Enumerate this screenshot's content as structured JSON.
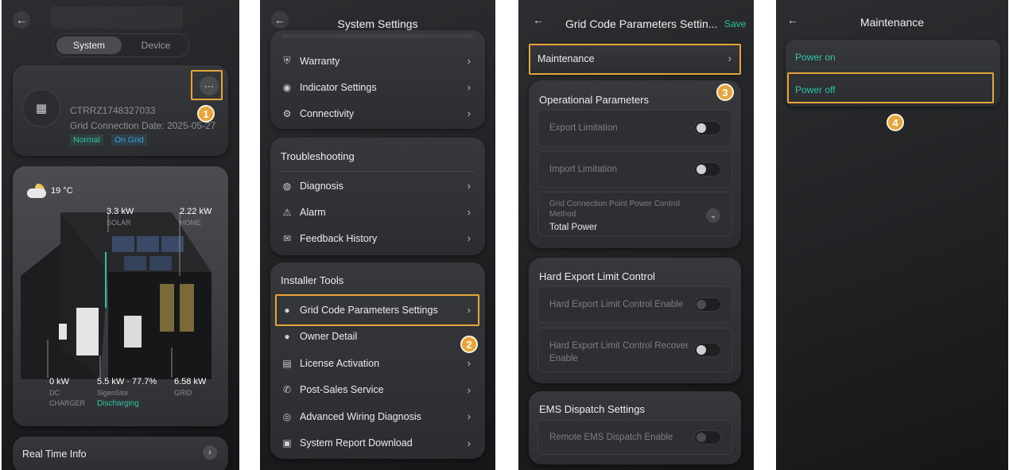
{
  "screen1": {
    "tabs": [
      "System",
      "Device"
    ],
    "device_id": "CTRRZ1748327033",
    "grid_date": "Grid Connection Date: 2025-05-27",
    "status_normal": "Normal",
    "status_grid": "On Grid",
    "weather_temp": "19 °C",
    "solar_value": "3.3 kW",
    "solar_label": "SOLAR",
    "home_value": "2.22 kW",
    "home_label": "HOME",
    "dc_value": "0 kW",
    "dc_label1": "DC",
    "dc_label2": "CHARGER",
    "battery_value": "5.5 kW · 77.7%",
    "battery_label": "SigenStor",
    "battery_state": "Discharging",
    "grid_value": "6.58 kW",
    "grid_label": "GRID",
    "realtime": "Real Time Info",
    "more": "···",
    "step": "1"
  },
  "screen2": {
    "title": "System Settings",
    "top_items": [
      {
        "icon": "warranty-icon",
        "glyph": "⛨",
        "label": "Warranty"
      },
      {
        "icon": "indicator-icon",
        "glyph": "◉",
        "label": "Indicator Settings"
      },
      {
        "icon": "connectivity-icon",
        "glyph": "⚙",
        "label": "Connectivity"
      }
    ],
    "troubleshooting_title": "Troubleshooting",
    "troubleshooting_items": [
      {
        "icon": "diagnosis-icon",
        "glyph": "◍",
        "label": "Diagnosis"
      },
      {
        "icon": "alarm-icon",
        "glyph": "⚠",
        "label": "Alarm"
      },
      {
        "icon": "feedback-icon",
        "glyph": "✉",
        "label": "Feedback History"
      }
    ],
    "installer_title": "Installer Tools",
    "installer_items": [
      {
        "icon": "grid-code-icon",
        "glyph": "●",
        "label": "Grid Code Parameters Settings"
      },
      {
        "icon": "owner-icon",
        "glyph": "●",
        "label": "Owner Detail"
      },
      {
        "icon": "license-icon",
        "glyph": "▤",
        "label": "License Activation"
      },
      {
        "icon": "post-sales-icon",
        "glyph": "✆",
        "label": "Post-Sales Service"
      },
      {
        "icon": "wiring-icon",
        "glyph": "◎",
        "label": "Advanced Wiring Diagnosis"
      },
      {
        "icon": "report-icon",
        "glyph": "▣",
        "label": "System Report Download"
      }
    ],
    "step": "2"
  },
  "screen3": {
    "title": "Grid Code Parameters Settin...",
    "save": "Save",
    "maintenance": "Maintenance",
    "op_title": "Operational Parameters",
    "export_limitation": "Export Limitation",
    "import_limitation": "Import Limitation",
    "gcp_label": "Grid Connection Point Power Control Method",
    "gcp_value": "Total Power",
    "hard_title": "Hard Export Limit Control",
    "hard_enable": "Hard Export Limit Control Enable",
    "hard_recover": "Hard Export Limit Control Recover Enable",
    "ems_title": "EMS Dispatch Settings",
    "ems_enable": "Remote EMS Dispatch Enable",
    "step": "3"
  },
  "screen4": {
    "title": "Maintenance",
    "power_on": "Power on",
    "power_off": "Power off",
    "step": "4"
  },
  "colors": {
    "accent": "#e6a43a",
    "teal": "#2fc4a5",
    "blue_status": "#3aa0d8"
  }
}
